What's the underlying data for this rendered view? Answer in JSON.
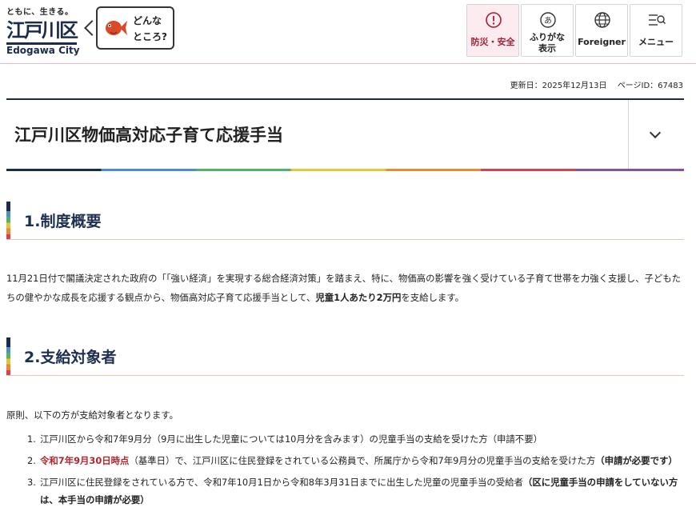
{
  "header": {
    "logo_tagline": "ともに、生きる。",
    "logo_text": "江戸川区",
    "logo_city": "Edogawa City",
    "donna_text": "どんな\nところ?",
    "tools": [
      {
        "label": "防災・安全",
        "icon": "alert-icon"
      },
      {
        "label": "ふりがな\n表示",
        "icon": "furigana-icon"
      },
      {
        "label": "Foreigner",
        "icon": "globe-icon"
      },
      {
        "label": "メニュー",
        "icon": "menu-icon"
      }
    ]
  },
  "meta": {
    "updated": "更新日：2025年12月13日",
    "page_id": "ページID：67483"
  },
  "page_title": "江戸川区物価高対応子育て応援手当",
  "sections": [
    {
      "heading": "1.制度概要",
      "body_1": "11月21日付で閣議決定された政府の「「強い経済」を実現する総合経済対策」を踏まえ、特に、物価高の影響を強く受けている子育て世帯を力強く支援し、子どもたちの健やかな成長を応援する観点から、物価高対応子育て応援手当として、",
      "body_bold": "児童1人あたり2万円",
      "body_2": "を支給します。"
    },
    {
      "heading": "2.支給対象者",
      "intro": "原則、以下の方が支給対象者となります。",
      "items": [
        {
          "num": "1.",
          "pre": "",
          "red": "",
          "text": "江戸川区から令和7年9月分（9月に出生した児童については10月分を含みます）の児童手当の支給を受けた方（申請不要）",
          "bold": ""
        },
        {
          "num": "2.",
          "pre": "",
          "red": "令和7年9月30日時点",
          "text": "（基準日）で、江戸川区に住民登録をされている公務員で、所属庁から令和7年9月分の児童手当の支給を受けた方",
          "bold": "（申請が必要です）"
        },
        {
          "num": "3.",
          "pre": "",
          "red": "",
          "text": "江戸川区に住民登録をされている方で、令和7年10月1日から令和8年3月31日までに出生した児童の児童手当の受給者",
          "bold": "（区に児童手当の申請をしていない方は、本手当の申請が必要）"
        }
      ]
    }
  ],
  "colors": {
    "navy": "#1a2b4c",
    "accent_red": "#b3262e",
    "bousai_bg": "#fdecef"
  }
}
